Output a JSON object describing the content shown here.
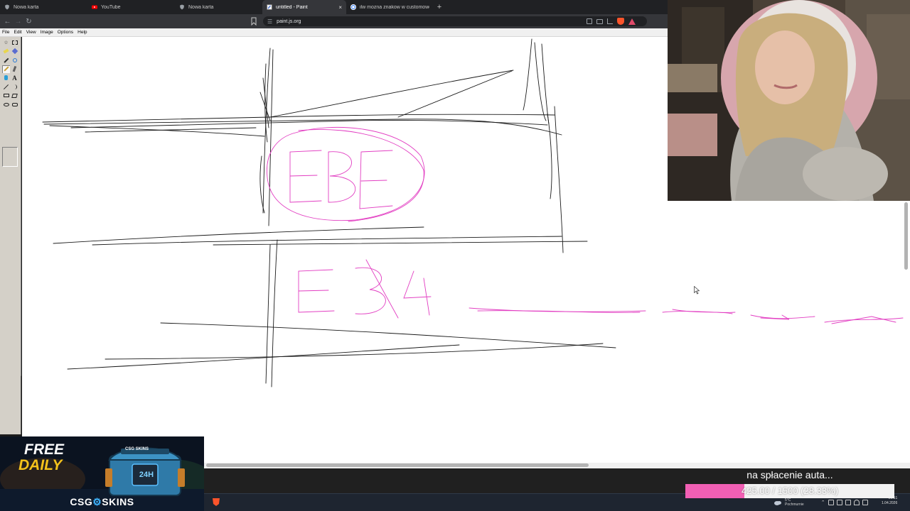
{
  "browser": {
    "tabs": [
      {
        "label": "Nowa karta",
        "icon": "shield-icon",
        "active": false
      },
      {
        "label": "YouTube",
        "icon": "youtube-icon",
        "active": false
      },
      {
        "label": "Nowa karta",
        "icon": "shield-icon",
        "active": false
      },
      {
        "label": "untitled - Paint",
        "icon": "paint-icon",
        "active": true
      },
      {
        "label": "ilw mozna znakow w customowej n",
        "icon": "google-icon",
        "active": false
      }
    ],
    "new_tab_label": "+",
    "close_tab_label": "×",
    "url": "paint.js.org"
  },
  "paint": {
    "menu": [
      "File",
      "Edit",
      "View",
      "Image",
      "Options",
      "Help"
    ],
    "tools": [
      "free-select-icon",
      "rect-select-icon",
      "eraser-icon",
      "fill-bucket-icon",
      "color-picker-icon",
      "magnifier-icon",
      "pencil-icon",
      "brush-icon",
      "airbrush-icon",
      "text-icon",
      "line-icon",
      "curve-icon",
      "rectangle-icon",
      "polygon-icon",
      "ellipse-icon",
      "rounded-rect-icon"
    ],
    "selected_tool": "pencil-icon",
    "text_tool_glyph": "A"
  },
  "stream": {
    "goal_text": "na spłacenie auta...",
    "goal_label": "425.00 / 1500 (28.33%)",
    "goal_current": 425.0,
    "goal_target": 1500,
    "goal_fraction": 0.2833,
    "goal_color": "#f15fb4"
  },
  "ad": {
    "free": "FREE",
    "daily": "DAILY",
    "badge": "24H",
    "chest_brand": "CSG SKINS",
    "brand_left": "CSG",
    "brand_right": "SKINS"
  },
  "taskbar": {
    "weather_line1": "5°C",
    "weather_line2": "Pochmurnie",
    "time": "21:51",
    "date": "1.04.2026"
  },
  "colors": {
    "sketch_black": "#1a1a1a",
    "sketch_pink": "#e23ec2",
    "chrome_dark": "#202124",
    "chrome_bar": "#35363a"
  }
}
